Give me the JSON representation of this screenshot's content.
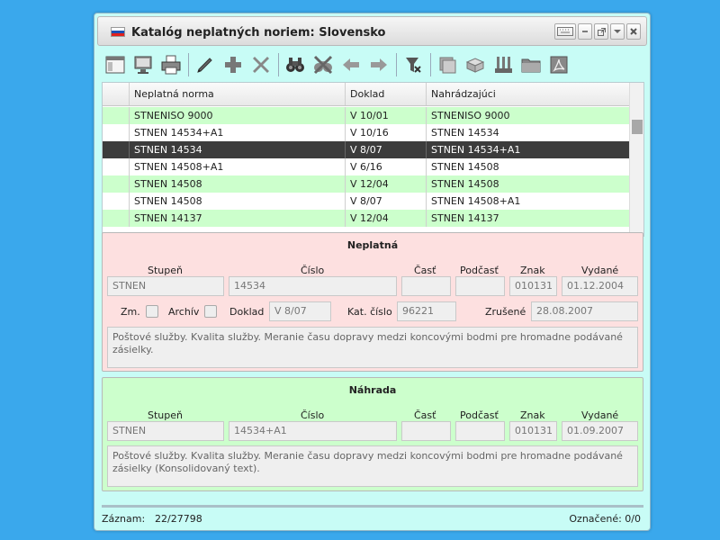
{
  "window": {
    "title": "Katalóg neplatných noriem: Slovensko",
    "flag_icon": "slovakia-flag-icon",
    "controls": [
      "keyboard-icon",
      "minimize-icon",
      "popout-icon",
      "dropdown-icon",
      "close-icon"
    ]
  },
  "toolbar": {
    "buttons": [
      "view-icon",
      "monitor-icon",
      "print-icon",
      "edit-icon",
      "add-icon",
      "delete-icon",
      "search-binoculars-icon",
      "search-off-icon",
      "back-arrow-icon",
      "forward-arrow-icon",
      "filter-icon",
      "stack-icon",
      "box-icon",
      "tools-icon",
      "folder-icon",
      "acrobat-icon"
    ]
  },
  "grid": {
    "columns": [
      "",
      "Neplatná norma",
      "Doklad",
      "Nahrádzajúci"
    ],
    "rows": [
      {
        "norma": "STNENISO 9000",
        "doklad": "V 10/01",
        "nahr": "STNENISO 9000",
        "style": "green"
      },
      {
        "norma": "STNEN 14534+A1",
        "doklad": "V 10/16",
        "nahr": "STNEN 14534",
        "style": "white"
      },
      {
        "norma": "STNEN 14534",
        "doklad": "V 8/07",
        "nahr": "STNEN 14534+A1",
        "style": "sel"
      },
      {
        "norma": "STNEN 14508+A1",
        "doklad": "V 6/16",
        "nahr": "STNEN 14508",
        "style": "white"
      },
      {
        "norma": "STNEN 14508",
        "doklad": "V 12/04",
        "nahr": "STNEN 14508",
        "style": "green"
      },
      {
        "norma": "STNEN 14508",
        "doklad": "V 8/07",
        "nahr": "STNEN 14508+A1",
        "style": "white"
      },
      {
        "norma": "STNEN 14137",
        "doklad": "V 12/04",
        "nahr": "STNEN 14137",
        "style": "green"
      }
    ]
  },
  "neplatna": {
    "title": "Neplatná",
    "labels": {
      "stupen": "Stupeň",
      "cislo": "Číslo",
      "cast": "Časť",
      "podcast": "Podčasť",
      "znak": "Znak",
      "vydane": "Vydané",
      "zm": "Zm.",
      "archiv": "Archív",
      "doklad": "Doklad",
      "kat_cislo": "Kat. číslo",
      "zrusene": "Zrušené"
    },
    "values": {
      "stupen": "STNEN",
      "cislo": "14534",
      "cast": "",
      "podcast": "",
      "znak": "010131",
      "vydane": "01.12.2004",
      "doklad": "V 8/07",
      "kat_cislo": "96221",
      "zrusene": "28.08.2007"
    },
    "description": "Poštové služby. Kvalita služby. Meranie času dopravy medzi koncovými bodmi pre hromadne podávané zásielky."
  },
  "nahrada": {
    "title": "Náhrada",
    "labels": {
      "stupen": "Stupeň",
      "cislo": "Číslo",
      "cast": "Časť",
      "podcast": "Podčasť",
      "znak": "Znak",
      "vydane": "Vydané"
    },
    "values": {
      "stupen": "STNEN",
      "cislo": "14534+A1",
      "cast": "",
      "podcast": "",
      "znak": "010131",
      "vydane": "01.09.2007"
    },
    "description": "Poštové služby. Kvalita služby. Meranie času dopravy medzi koncovými bodmi pre hromadne podávané zásielky (Konsolidovaný text)."
  },
  "status": {
    "zaznam_label": "Záznam:",
    "zaznam_value": "22/27798",
    "oznacene": "Označené: 0/0"
  }
}
